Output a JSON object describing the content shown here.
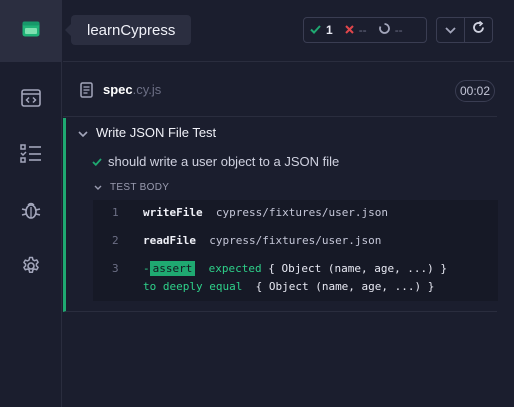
{
  "app": {
    "project_name": "learnCypress"
  },
  "sidebar": {
    "items": [
      {
        "icon": "project-icon"
      },
      {
        "icon": "specs-icon"
      },
      {
        "icon": "runs-icon"
      },
      {
        "icon": "debug-icon"
      },
      {
        "icon": "settings-icon"
      }
    ]
  },
  "stats": {
    "passed": "1",
    "failed": "--",
    "pending": "--"
  },
  "spec": {
    "name": "spec",
    "ext": ".cy.js",
    "duration": "00:02"
  },
  "suite": {
    "title": "Write JSON File Test"
  },
  "test": {
    "title": "should write a user object to a JSON file",
    "body_label": "TEST BODY"
  },
  "commands": [
    {
      "num": "1",
      "name": "writeFile",
      "message": "cypress/fixtures/user.json"
    },
    {
      "num": "2",
      "name": "readFile",
      "message": "cypress/fixtures/user.json"
    },
    {
      "num": "3",
      "prefix": "-",
      "badge": "assert",
      "line1_a": "expected",
      "line1_b": "{ Object (name, age, ...) }",
      "line2_a": "to deeply equal",
      "line2_b": "{ Object (name, age, ...) }"
    }
  ],
  "colors": {
    "pass": "#1fa971",
    "fail": "#e0464b",
    "background": "#1b1e2e"
  }
}
